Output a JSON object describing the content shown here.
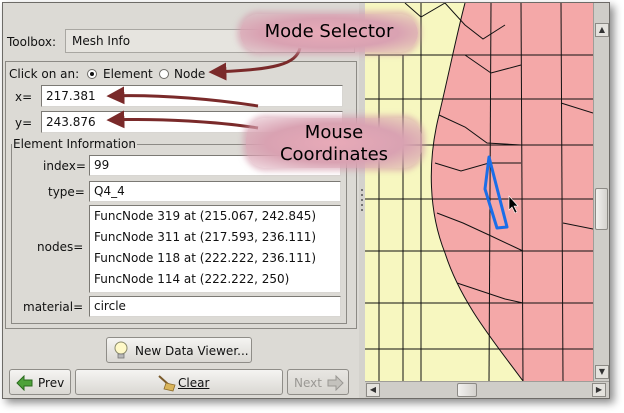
{
  "toolbox": {
    "label": "Toolbox:",
    "value": "Mesh Info"
  },
  "click_on": {
    "label": "Click on an:",
    "options": [
      "Element",
      "Node"
    ],
    "selected": "Element"
  },
  "coords": {
    "x_label": "x=",
    "x_value": "217.381",
    "y_label": "y=",
    "y_value": "243.876"
  },
  "element_info": {
    "title": "Element Information",
    "index_label": "index=",
    "index_value": "99",
    "type_label": "type=",
    "type_value": "Q4_4",
    "nodes_label": "nodes=",
    "nodes": [
      "FuncNode 319 at (215.067, 242.845)",
      "FuncNode 311 at (217.593, 236.111)",
      "FuncNode 118 at (222.222, 236.111)",
      "FuncNode 114 at (222.222, 250)"
    ],
    "material_label": "material=",
    "material_value": "circle"
  },
  "buttons": {
    "new_viewer": "New Data Viewer...",
    "prev": "Prev",
    "clear": "Clear",
    "next": "Next"
  },
  "annotations": {
    "mode_selector": "Mode Selector",
    "mouse_coordinates_line1": "Mouse",
    "mouse_coordinates_line2": "Coordinates"
  },
  "colors": {
    "mesh_yellow": "#f7f7c0",
    "mesh_pink": "#f4a8a8",
    "highlight": "#1a6ee8",
    "annotation_arrow": "#7a2a2a"
  }
}
